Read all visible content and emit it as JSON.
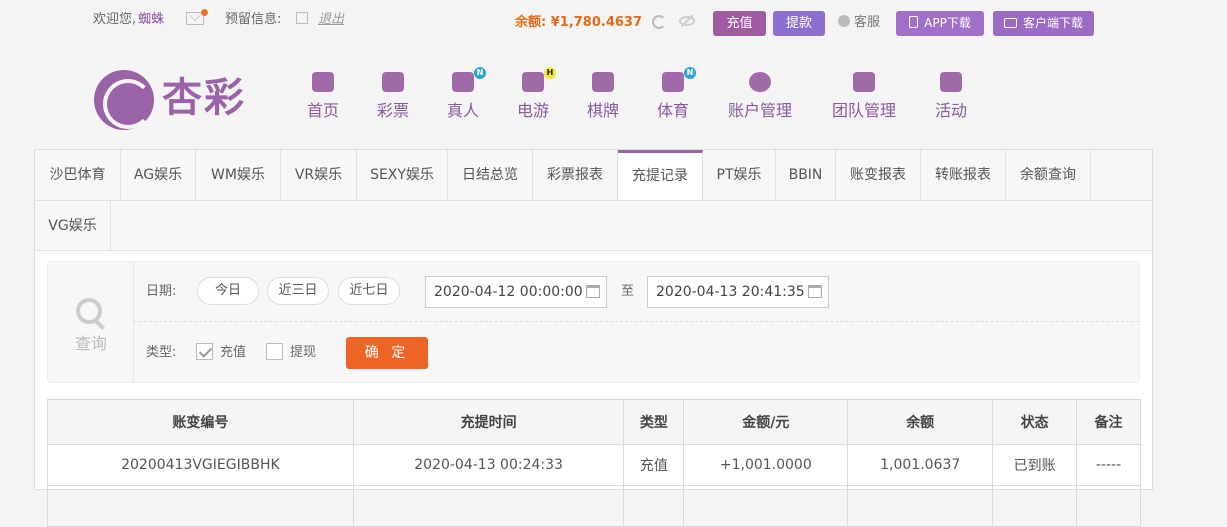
{
  "header": {
    "greeting_label": "欢迎您,",
    "username": "蜘蛛",
    "reserve_label": "预留信息:",
    "logout_label": "退出",
    "balance_text": "余额: ¥1,780.4637",
    "charge_label": "充值",
    "withdraw_label": "提款",
    "service_label": "客服",
    "app_download_label": "APP下载",
    "client_download_label": "客户端下载"
  },
  "logo": {
    "text": "杏彩"
  },
  "nav": [
    {
      "label": "首页",
      "icon": "home-icon",
      "badge": ""
    },
    {
      "label": "彩票",
      "icon": "lottery-ticket-icon",
      "badge": ""
    },
    {
      "label": "真人",
      "icon": "live-dealer-icon",
      "badge": "N"
    },
    {
      "label": "电游",
      "icon": "gamepad-icon",
      "badge": "H"
    },
    {
      "label": "棋牌",
      "icon": "cards-icon",
      "badge": ""
    },
    {
      "label": "体育",
      "icon": "trophy-icon",
      "badge": "N"
    },
    {
      "label": "账户管理",
      "icon": "yen-coin-icon",
      "badge": ""
    },
    {
      "label": "团队管理",
      "icon": "team-icon",
      "badge": ""
    },
    {
      "label": "活动",
      "icon": "gift-icon",
      "badge": ""
    }
  ],
  "tabs": [
    "沙巴体育",
    "AG娱乐",
    "WM娱乐",
    "VR娱乐",
    "SEXY娱乐",
    "日结总览",
    "彩票报表",
    "充提记录",
    "PT娱乐",
    "BBIN",
    "账变报表",
    "转账报表",
    "余额查询",
    "VG娱乐"
  ],
  "active_tab": "充提记录",
  "query": {
    "search_label": "查询",
    "date_label": "日期:",
    "today_label": "今日",
    "three_days_label": "近三日",
    "seven_days_label": "近七日",
    "start_date": "2020-04-12 00:00:00",
    "to_label": "至",
    "end_date": "2020-04-13 20:41:35",
    "type_label": "类型:",
    "type_charge_label": "充值",
    "type_withdraw_label": "提现",
    "confirm_label": "确 定"
  },
  "table": {
    "headers": [
      "账变编号",
      "充提时间",
      "类型",
      "金额/元",
      "余额",
      "状态",
      "备注"
    ],
    "rows": [
      [
        "20200413VGIEGIBBHK",
        "2020-04-13 00:24:33",
        "充值",
        "+1,001.0000",
        "1,001.0637",
        "已到账",
        "-----"
      ]
    ]
  },
  "colors": {
    "brand": "#9a63a8",
    "accent": "#ec6527",
    "positive": "#3b9a2b",
    "amount": "#d9352b"
  }
}
